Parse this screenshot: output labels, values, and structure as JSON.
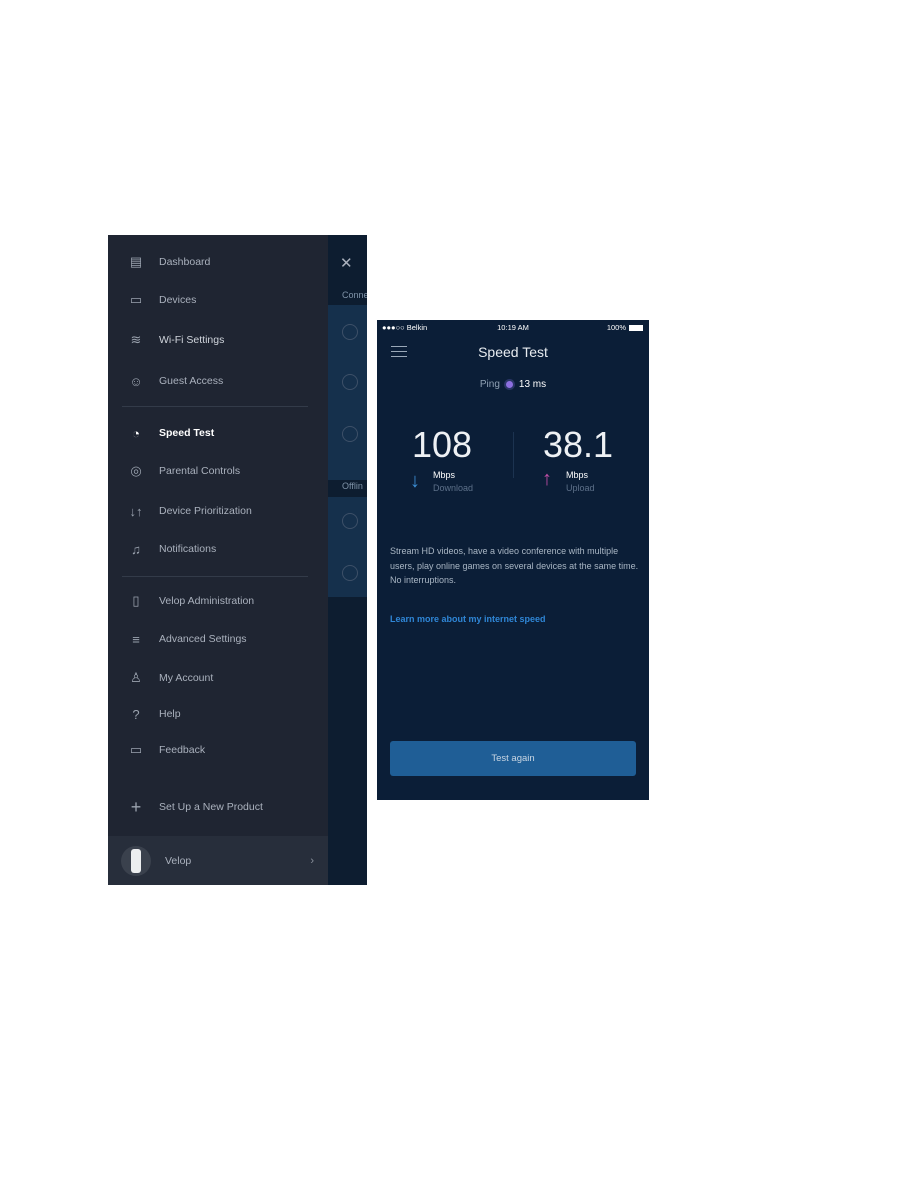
{
  "menu": {
    "items": [
      {
        "label": "Dashboard",
        "icon": "dashboard-icon"
      },
      {
        "label": "Devices",
        "icon": "devices-icon"
      },
      {
        "label": "Wi-Fi Settings",
        "icon": "wifi-icon"
      },
      {
        "label": "Guest Access",
        "icon": "guest-icon"
      },
      {
        "label": "Speed Test",
        "icon": "speedometer-icon",
        "active": true
      },
      {
        "label": "Parental Controls",
        "icon": "parental-lock-icon"
      },
      {
        "label": "Device Prioritization",
        "icon": "priority-arrows-icon"
      },
      {
        "label": "Notifications",
        "icon": "bell-icon"
      },
      {
        "label": "Velop Administration",
        "icon": "velop-node-icon"
      },
      {
        "label": "Advanced Settings",
        "icon": "sliders-icon"
      },
      {
        "label": "My Account",
        "icon": "user-icon"
      },
      {
        "label": "Help",
        "icon": "question-icon"
      },
      {
        "label": "Feedback",
        "icon": "chat-icon"
      },
      {
        "label": "Set Up a New Product",
        "icon": "plus-icon"
      }
    ],
    "footer": {
      "label": "Velop"
    }
  },
  "background_panel": {
    "connected_label": "Conne",
    "offline_label": "Offlin"
  },
  "phone": {
    "status_bar": {
      "carrier": "●●●○○ Belkin",
      "time": "10:19 AM",
      "battery": "100%"
    },
    "title": "Speed Test",
    "ping": {
      "label": "Ping",
      "value": "13 ms"
    },
    "download": {
      "value": "108",
      "unit": "Mbps",
      "label": "Download",
      "color": "#3c8fd6"
    },
    "upload": {
      "value": "38.1",
      "unit": "Mbps",
      "label": "Upload",
      "color": "#c04fa6"
    },
    "description": "Stream HD videos, have a video conference with multiple users, play online games on several devices at the same time. No interruptions.",
    "learn_more": "Learn more about my internet speed",
    "button": "Test again",
    "colors": {
      "accent": "#1f5e96",
      "link": "#2f86d6",
      "ping_dot": "#8d6fe0"
    }
  }
}
